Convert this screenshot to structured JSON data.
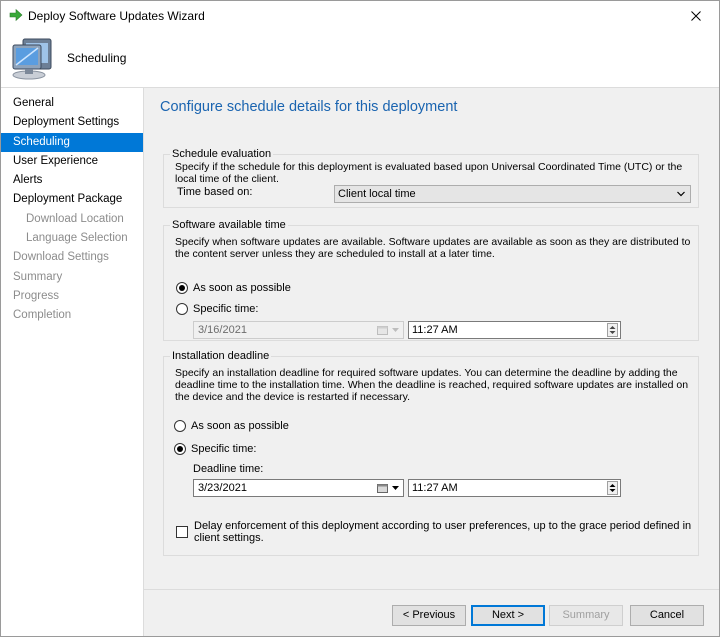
{
  "window": {
    "title": "Deploy Software Updates Wizard"
  },
  "header": {
    "title": "Scheduling"
  },
  "nav": {
    "items": [
      {
        "label": "General"
      },
      {
        "label": "Deployment Settings"
      },
      {
        "label": "Scheduling"
      },
      {
        "label": "User Experience"
      },
      {
        "label": "Alerts"
      },
      {
        "label": "Deployment Package"
      },
      {
        "label": "Download Location"
      },
      {
        "label": "Language Selection"
      },
      {
        "label": "Download Settings"
      },
      {
        "label": "Summary"
      },
      {
        "label": "Progress"
      },
      {
        "label": "Completion"
      }
    ]
  },
  "page": {
    "heading": "Configure schedule details for this deployment"
  },
  "schedule_evaluation": {
    "legend": "Schedule evaluation",
    "description": "Specify if the schedule for this deployment is evaluated based upon Universal Coordinated Time (UTC) or the local time of the client.",
    "time_based_label": "Time based on:",
    "time_based_value": "Client local time"
  },
  "available_time": {
    "legend": "Software available time",
    "description": "Specify when software updates are available. Software updates are available as soon as they are distributed to the content server unless they are scheduled to install at a later time.",
    "asap_label": "As soon as possible",
    "specific_label": "Specific time:",
    "date": "3/16/2021",
    "time": "11:27 AM"
  },
  "deadline": {
    "legend": "Installation deadline",
    "description": "Specify an installation deadline for required software updates. You can determine the deadline by adding the deadline time to the installation time. When the deadline is reached, required software updates are installed on the device and the device is restarted if necessary.",
    "asap_label": "As soon as possible",
    "specific_label": "Specific time:",
    "deadline_time_label": "Deadline time:",
    "date": "3/23/2021",
    "time": "11:27 AM",
    "delay_label": "Delay enforcement of this deployment according to user preferences, up to the grace period defined in client settings."
  },
  "buttons": {
    "previous": "< Previous",
    "next": "Next >",
    "summary": "Summary",
    "cancel": "Cancel"
  }
}
